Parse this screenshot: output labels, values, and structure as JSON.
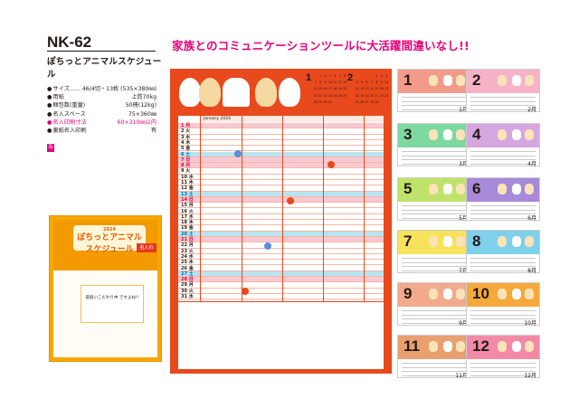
{
  "product": {
    "code": "NK-62",
    "name": "ぽちっとアニマルスケジュール",
    "specs": [
      {
        "label": "サイズ……",
        "value": "46/4切・13枚 (535×380㎜)",
        "highlight": false
      },
      {
        "label": "用紙",
        "value": "上質70kg",
        "highlight": false
      },
      {
        "label": "梱包数(重量)",
        "value": "50冊(12kg)",
        "highlight": false
      },
      {
        "label": "名入スペース",
        "value": "75×360㎜",
        "highlight": false
      },
      {
        "label": "名入印刷寸法",
        "value": "60×310㎜以内",
        "highlight": true
      },
      {
        "label": "裏紙名入印刷",
        "value": "有",
        "highlight": false
      }
    ],
    "badge": "有"
  },
  "thumbnail": {
    "title_top": "2024",
    "title": "ぽちっとアニマル",
    "subtitle": "スケジュール",
    "tag": "名入れ",
    "note": "取扱いこだわり中 ですよね!!"
  },
  "headline": "家族とのコミュニケーションツールに大活躍間違いなし!!",
  "main_calendar": {
    "month_name": "January 2024",
    "big_months": [
      "1",
      "2"
    ],
    "dates": [
      "1 月",
      "2 火",
      "3 水",
      "4 木",
      "5 金",
      "6 土",
      "7 日",
      "8 月",
      "9 火",
      "10 水",
      "11 木",
      "12 金",
      "13 土",
      "14 日",
      "15 月",
      "16 火",
      "17 水",
      "18 木",
      "19 金",
      "20 土",
      "21 日",
      "22 月",
      "23 火",
      "24 水",
      "25 木",
      "26 金",
      "27 土",
      "28 日",
      "29 月",
      "30 火",
      "31 水"
    ],
    "colors": {
      "frame": "#e8491d",
      "sat": "#b8e4f0",
      "sun": "#f9c8d2",
      "holiday": "#f9c8d2"
    }
  },
  "months": [
    {
      "num": "1",
      "caption": "1月",
      "color": "#f29b8b"
    },
    {
      "num": "2",
      "caption": "2月",
      "color": "#f6b3c8"
    },
    {
      "num": "3",
      "caption": "3月",
      "color": "#7ed9a0"
    },
    {
      "num": "4",
      "caption": "4月",
      "color": "#d6a6e0"
    },
    {
      "num": "5",
      "caption": "5月",
      "color": "#bfe36a"
    },
    {
      "num": "6",
      "caption": "6月",
      "color": "#a78bd8"
    },
    {
      "num": "7",
      "caption": "7月",
      "color": "#f7e35b"
    },
    {
      "num": "8",
      "caption": "8月",
      "color": "#7fd0ea"
    },
    {
      "num": "9",
      "caption": "9月",
      "color": "#f2a98d"
    },
    {
      "num": "10",
      "caption": "10月",
      "color": "#f5a93c"
    },
    {
      "num": "11",
      "caption": "11月",
      "color": "#e8a070"
    },
    {
      "num": "12",
      "caption": "12月",
      "color": "#f28aa7"
    }
  ]
}
